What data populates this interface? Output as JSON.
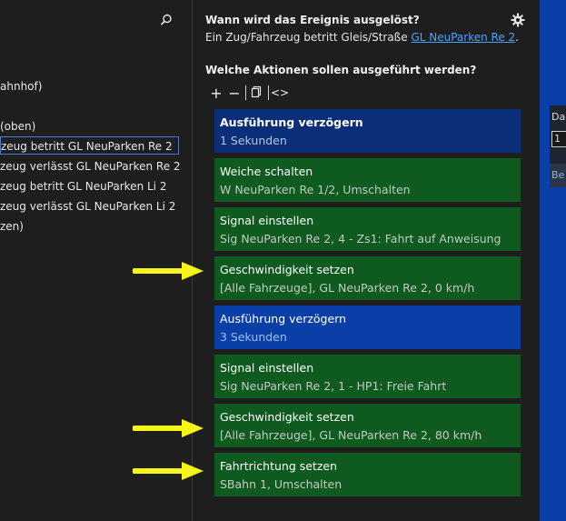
{
  "tree": {
    "items": [
      {
        "label": "ahnhof)",
        "selected": false
      },
      {
        "label": " (oben)",
        "selected": false
      },
      {
        "label": "zeug betritt GL NeuParken Re 2",
        "selected": true
      },
      {
        "label": "zeug verlässt GL NeuParken Re 2",
        "selected": false
      },
      {
        "label": "zeug betritt GL NeuParken Li 2",
        "selected": false
      },
      {
        "label": "zeug verlässt GL NeuParken Li 2",
        "selected": false
      },
      {
        "label": "zen)",
        "selected": false
      }
    ],
    "search_icon": "search-icon"
  },
  "trigger": {
    "question": "Wann wird das Ereignis ausgelöst?",
    "description_prefix": "Ein Zug/Fahrzeug betritt Gleis/Straße ",
    "link": "GL NeuParken Re 2",
    "description_suffix": "."
  },
  "actions_section": {
    "question": "Welche Aktionen sollen ausgeführt werden?",
    "toolbar": {
      "add": "+",
      "remove": "−",
      "code": "<>"
    }
  },
  "actions": [
    {
      "title": "Ausführung verzögern",
      "subtitle": "1 Sekunden",
      "variant": "navy"
    },
    {
      "title": "Weiche schalten",
      "subtitle": "W NeuParken Re 1/2, Umschalten",
      "variant": "green"
    },
    {
      "title": "Signal einstellen",
      "subtitle": "Sig NeuParken Re 2, 4 - Zs1:  Fahrt auf Anweisung",
      "variant": "green"
    },
    {
      "title": "Geschwindigkeit setzen",
      "subtitle": "[Alle Fahrzeuge], GL NeuParken Re 2, 0 km/h",
      "variant": "green"
    },
    {
      "title": "Ausführung verzögern",
      "subtitle": "3 Sekunden",
      "variant": "blue"
    },
    {
      "title": "Signal einstellen",
      "subtitle": "Sig NeuParken Re 2, 1 - HP1:  Freie Fahrt",
      "variant": "green"
    },
    {
      "title": "Geschwindigkeit setzen",
      "subtitle": "[Alle Fahrzeuge], GL NeuParken Re 2, 80 km/h",
      "variant": "green"
    },
    {
      "title": "Fahrtrichtung setzen",
      "subtitle": "SBahn 1, Umschalten",
      "variant": "green"
    }
  ],
  "right_panel": {
    "label": "Da",
    "input_value": "1",
    "button": "Be"
  },
  "colors": {
    "green_card": "#0f5a1f",
    "blue_card": "#0a3fa8",
    "navy_card": "#0a2f78",
    "arrow": "#f5f51a",
    "link": "#4aa3ff"
  }
}
